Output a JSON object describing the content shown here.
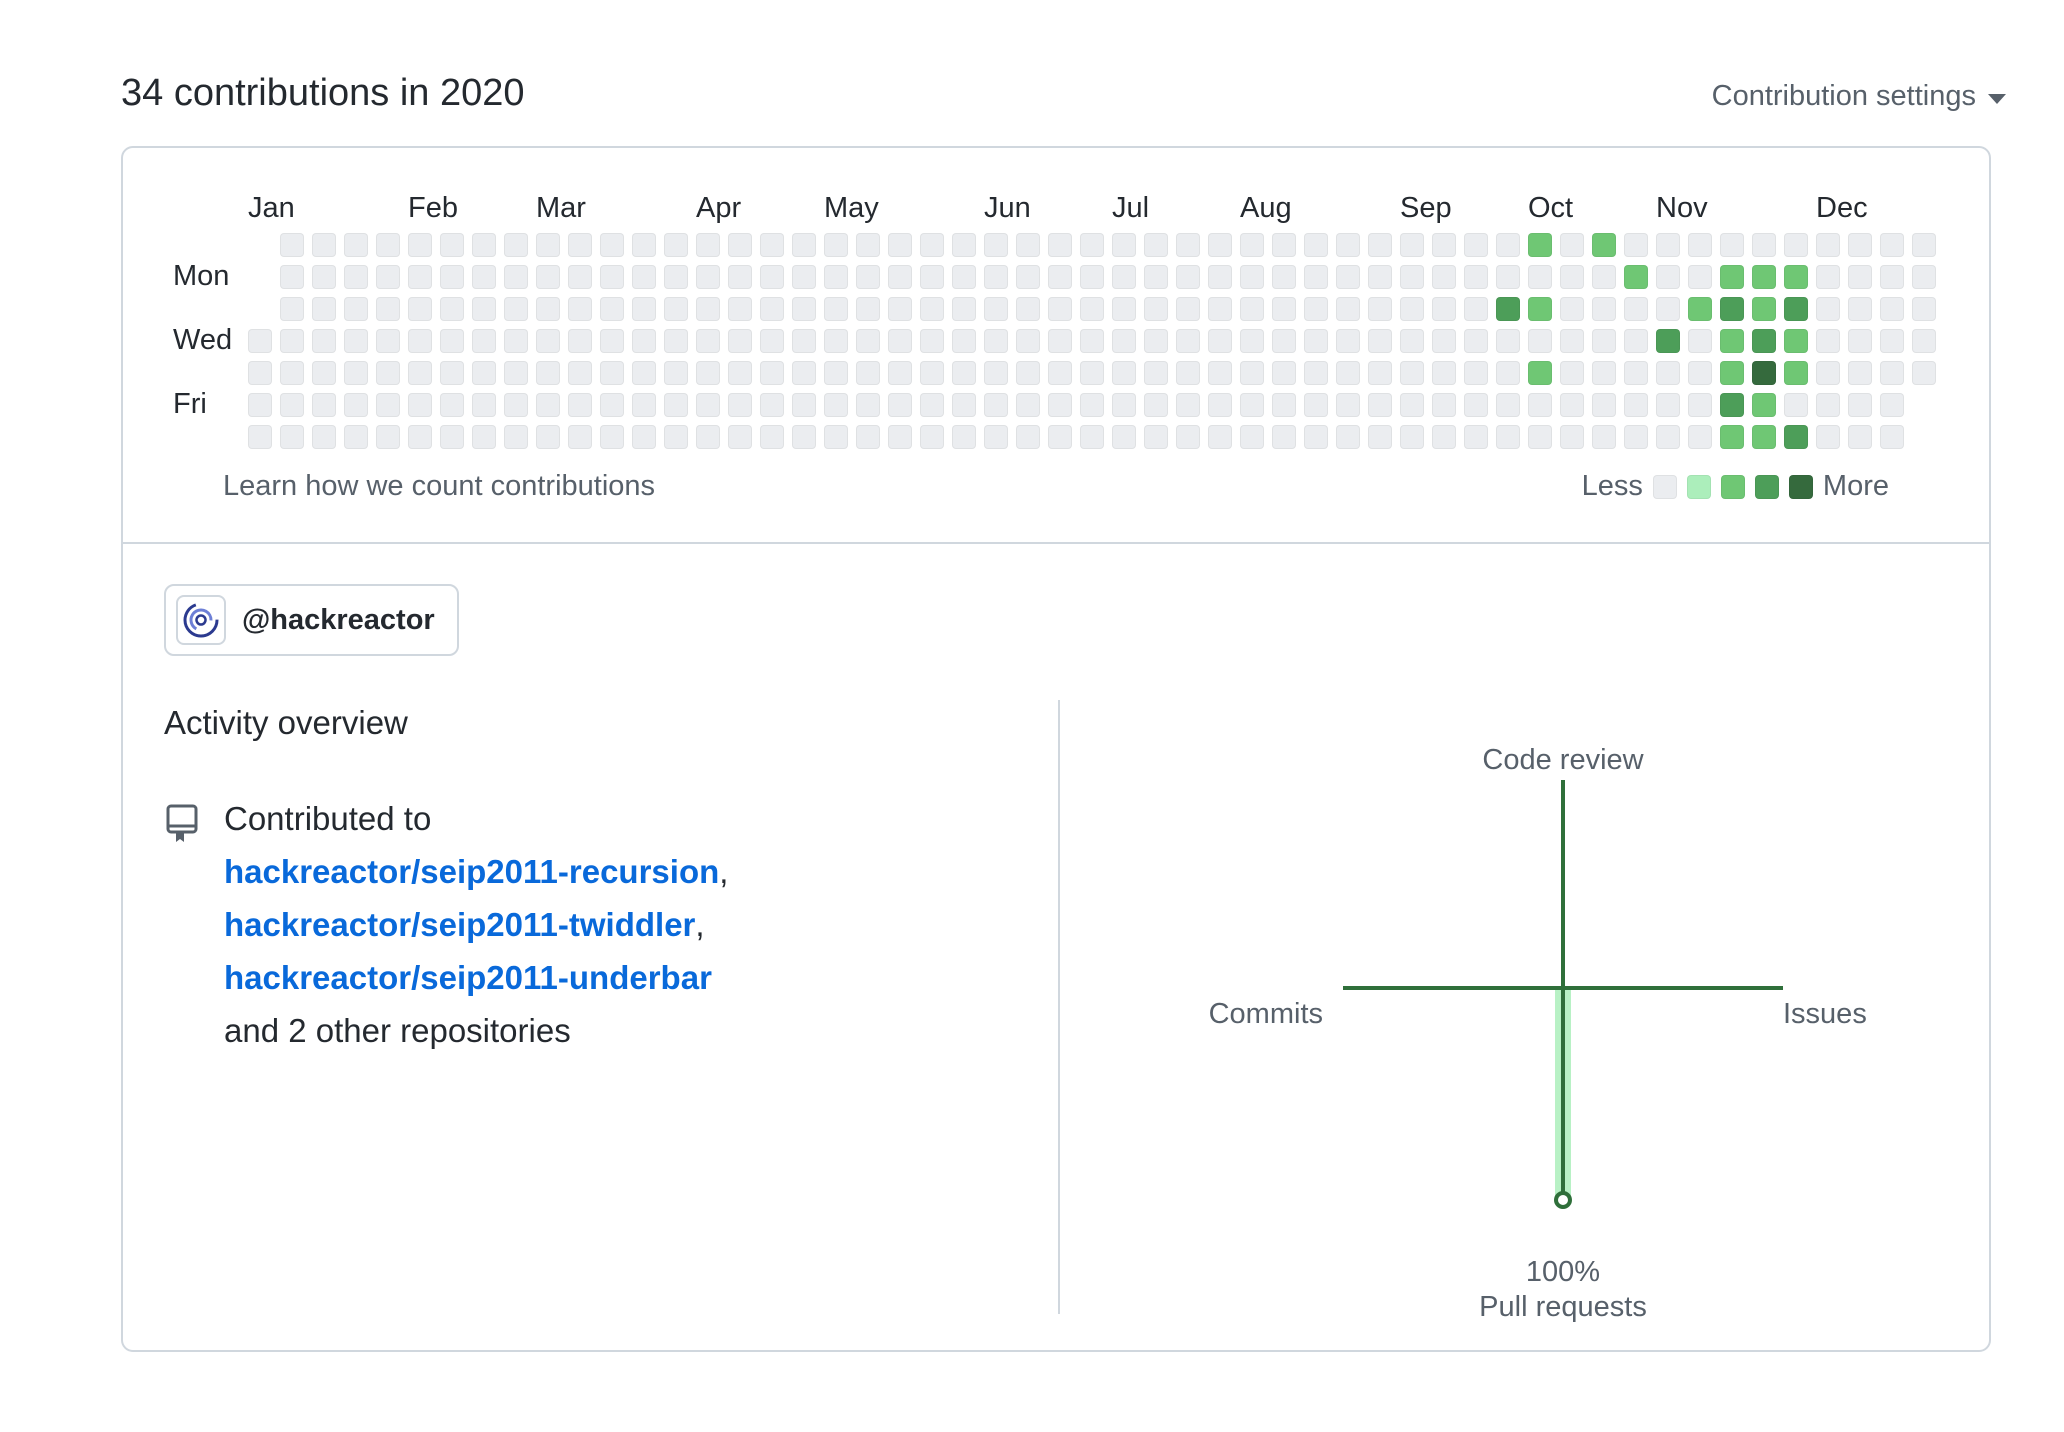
{
  "header": {
    "title": "34 contributions in 2020",
    "settings_label": "Contribution settings"
  },
  "calendar": {
    "months": [
      "Jan",
      "Feb",
      "Mar",
      "Apr",
      "May",
      "Jun",
      "Jul",
      "Aug",
      "Sep",
      "Oct",
      "Nov",
      "Dec"
    ],
    "day_labels": [
      "Mon",
      "Wed",
      "Fri"
    ],
    "learn_link": "Learn how we count contributions",
    "legend_less": "Less",
    "legend_more": "More",
    "level_colors": [
      "#ebedf0",
      "#aceebb",
      "#6fc774",
      "#4d9e59",
      "#356a3d"
    ],
    "active_days": [
      {
        "week": 40,
        "day": 0,
        "level": 2
      },
      {
        "week": 42,
        "day": 0,
        "level": 2
      },
      {
        "week": 43,
        "day": 1,
        "level": 2
      },
      {
        "week": 46,
        "day": 1,
        "level": 2
      },
      {
        "week": 47,
        "day": 1,
        "level": 2
      },
      {
        "week": 48,
        "day": 1,
        "level": 2
      },
      {
        "week": 39,
        "day": 2,
        "level": 3
      },
      {
        "week": 40,
        "day": 2,
        "level": 2
      },
      {
        "week": 45,
        "day": 2,
        "level": 2
      },
      {
        "week": 46,
        "day": 2,
        "level": 3
      },
      {
        "week": 47,
        "day": 2,
        "level": 2
      },
      {
        "week": 48,
        "day": 2,
        "level": 3
      },
      {
        "week": 44,
        "day": 3,
        "level": 3
      },
      {
        "week": 46,
        "day": 3,
        "level": 2
      },
      {
        "week": 47,
        "day": 3,
        "level": 3
      },
      {
        "week": 48,
        "day": 3,
        "level": 2
      },
      {
        "week": 40,
        "day": 4,
        "level": 2
      },
      {
        "week": 46,
        "day": 4,
        "level": 2
      },
      {
        "week": 47,
        "day": 4,
        "level": 4
      },
      {
        "week": 48,
        "day": 4,
        "level": 2
      },
      {
        "week": 46,
        "day": 5,
        "level": 3
      },
      {
        "week": 47,
        "day": 5,
        "level": 2
      },
      {
        "week": 46,
        "day": 6,
        "level": 2
      },
      {
        "week": 47,
        "day": 6,
        "level": 2
      },
      {
        "week": 48,
        "day": 6,
        "level": 3
      }
    ]
  },
  "org": {
    "handle": "@hackreactor",
    "logo_icon": "hackreactor-logo-icon"
  },
  "activity": {
    "title": "Activity overview",
    "contributed_to": "Contributed to",
    "repos": [
      "hackreactor/seip2011-recursion",
      "hackreactor/seip2011-twiddler",
      "hackreactor/seip2011-underbar"
    ],
    "others": "and 2 other repositories",
    "repo_icon": "repo-icon"
  },
  "overview_chart": {
    "axes": {
      "top": "Code review",
      "left": "Commits",
      "right": "Issues",
      "bottom": "Pull requests"
    },
    "values": {
      "code_review": 0,
      "commits": 0,
      "issues": 0,
      "pull_requests": 100
    },
    "bottom_value_label": "100%",
    "axis_color": "#2f6f3a",
    "fill_color": "#aceebb"
  }
}
